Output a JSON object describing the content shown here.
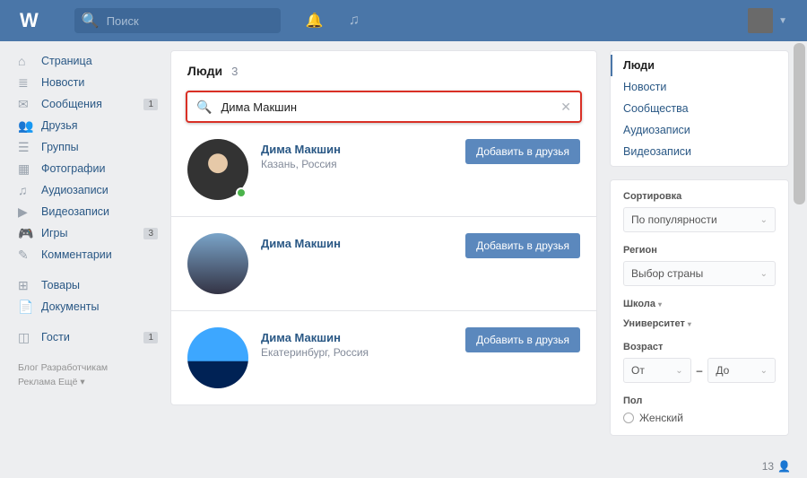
{
  "header": {
    "logo": "W",
    "search_placeholder": "Поиск"
  },
  "sidebar": {
    "items": [
      {
        "icon": "⌂",
        "label": "Страница"
      },
      {
        "icon": "≣",
        "label": "Новости"
      },
      {
        "icon": "✉",
        "label": "Сообщения",
        "badge": "1"
      },
      {
        "icon": "👥",
        "label": "Друзья"
      },
      {
        "icon": "☰",
        "label": "Группы"
      },
      {
        "icon": "▦",
        "label": "Фотографии"
      },
      {
        "icon": "♫",
        "label": "Аудиозаписи"
      },
      {
        "icon": "▶",
        "label": "Видеозаписи"
      },
      {
        "icon": "🎮",
        "label": "Игры",
        "badge": "3"
      },
      {
        "icon": "✎",
        "label": "Комментарии"
      }
    ],
    "items2": [
      {
        "icon": "⊞",
        "label": "Товары"
      },
      {
        "icon": "📄",
        "label": "Документы"
      }
    ],
    "items3": [
      {
        "icon": "◫",
        "label": "Гости",
        "badge": "1"
      }
    ],
    "footer": {
      "l1": "Блог   Разработчикам",
      "l2": "Реклама   Ещё ▾"
    }
  },
  "main": {
    "title": "Люди",
    "count": "3",
    "search_value": "Дима Макшин",
    "add_label": "Добавить в друзья",
    "results": [
      {
        "name": "Дима Макшин",
        "location": "Казань, Россия",
        "online": true
      },
      {
        "name": "Дима Макшин",
        "location": "",
        "online": false
      },
      {
        "name": "Дима Макшин",
        "location": "Екатеринбург, Россия",
        "online": false
      }
    ]
  },
  "right": {
    "tabs": [
      "Люди",
      "Новости",
      "Сообщества",
      "Аудиозаписи",
      "Видеозаписи"
    ],
    "sort_label": "Сортировка",
    "sort_value": "По популярности",
    "region_label": "Регион",
    "region_value": "Выбор страны",
    "school_label": "Школа",
    "univ_label": "Университет",
    "age_label": "Возраст",
    "age_from": "От",
    "age_to": "До",
    "sex_label": "Пол",
    "sex_female": "Женский"
  },
  "status": {
    "count": "13"
  }
}
